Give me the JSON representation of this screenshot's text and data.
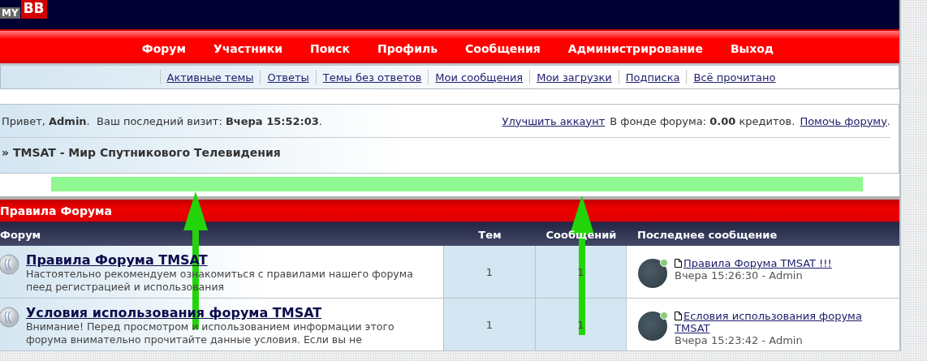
{
  "logo": {
    "part_1": "MY",
    "part_2": "BB"
  },
  "menu": [
    {
      "label": "Форум"
    },
    {
      "label": "Участники"
    },
    {
      "label": "Поиск"
    },
    {
      "label": "Профиль"
    },
    {
      "label": "Сообщения"
    },
    {
      "label": "Администрирование"
    },
    {
      "label": "Выход"
    }
  ],
  "quick_links": [
    {
      "label": "Активные темы"
    },
    {
      "label": "Ответы"
    },
    {
      "label": "Темы без ответов"
    },
    {
      "label": "Мои сообщения"
    },
    {
      "label": "Мои загрузки"
    },
    {
      "label": "Подписка"
    },
    {
      "label": "Всё прочитано"
    }
  ],
  "welcome": {
    "text": "Привет, **Admin**.  Ваш последний визит: **Вчера 15:52:03**.",
    "upgrade_link": "Улучшить аккаунт",
    "fund_text": "В фонде форума: **0.00** кредитов.",
    "donate_link": "Помочь форуму",
    "end": "."
  },
  "breadcrumb": "» TMSAT - Мир Спутникового Телевидения",
  "annotations": [
    {
      "kind": "highlight"
    },
    {
      "kind": "arrow"
    },
    {
      "kind": "arrow"
    }
  ],
  "table": {
    "category": "Правила Форума",
    "columns": [
      "Форум",
      "Тем",
      "Сообщений",
      "Последнее сообщение"
    ],
    "rows": [
      {
        "title": "Правила Форума TMSAT",
        "description": "Настоятельно рекомендуем ознакомиться с правилами нашего форума пеед регистрацией и использования",
        "topics": "1",
        "posts": "1",
        "last_post": {
          "online": true,
          "link": "Правила Форума TMSAT !!!",
          "time": "Вчера 15:26:30 - Admin"
        }
      },
      {
        "title": "Условия использования форума TMSAT",
        "description": "Внимание! Перед просмотром и использованием информации этого форума внимательно прочитайте данные условия. Если вы не",
        "topics": "1",
        "posts": "1",
        "last_post": {
          "online": true,
          "link": "Есловия использования форума TMSAT",
          "time": "Вчера 15:23:42 - Admin"
        }
      }
    ]
  }
}
